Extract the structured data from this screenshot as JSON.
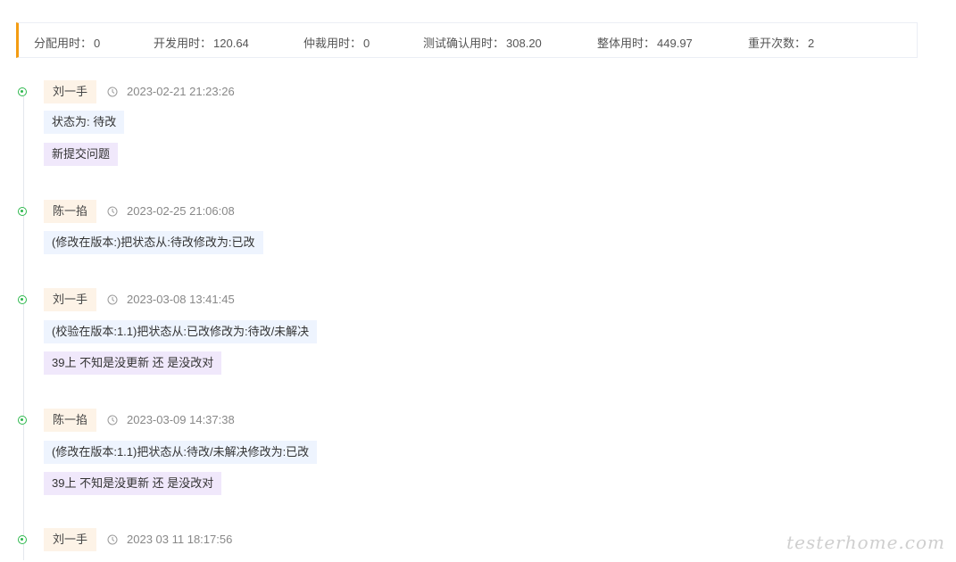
{
  "stats": [
    {
      "label": "分配用时：",
      "value": "0"
    },
    {
      "label": "开发用时：",
      "value": "120.64"
    },
    {
      "label": "仲裁用时：",
      "value": "0"
    },
    {
      "label": "测试确认用时：",
      "value": "308.20"
    },
    {
      "label": "整体用时：",
      "value": "449.97"
    },
    {
      "label": "重开次数：",
      "value": "2"
    }
  ],
  "entries": [
    {
      "author": "刘一手",
      "time": "2023-02-21 21:23:26",
      "tags": [
        {
          "text": "状态为: 待改",
          "kind": "blue"
        },
        {
          "text": "新提交问题",
          "kind": "purple"
        }
      ]
    },
    {
      "author": "陈一掐",
      "time": "2023-02-25 21:06:08",
      "tags": [
        {
          "text": "(修改在版本:)把状态从:待改修改为:已改",
          "kind": "blue"
        }
      ]
    },
    {
      "author": "刘一手",
      "time": "2023-03-08 13:41:45",
      "tags": [
        {
          "text": "(校验在版本:1.1)把状态从:已改修改为:待改/未解决",
          "kind": "blue"
        },
        {
          "text": "39上 不知是没更新 还 是没改对",
          "kind": "purple"
        }
      ]
    },
    {
      "author": "陈一掐",
      "time": "2023-03-09 14:37:38",
      "tags": [
        {
          "text": "(修改在版本:1.1)把状态从:待改/未解决修改为:已改",
          "kind": "blue"
        },
        {
          "text": "39上 不知是没更新 还 是没改对",
          "kind": "purple"
        }
      ]
    },
    {
      "author": "刘一手",
      "time": "2023 03 11 18:17:56",
      "tags": []
    }
  ],
  "watermark": "testerhome.com",
  "colors": {
    "accent_orange": "#f39c12",
    "dot_green": "#2db84d",
    "author_bg": "#fdf3e7",
    "tag_blue_bg": "#eef4fe",
    "tag_purple_bg": "#f0e8fb"
  },
  "icons": {
    "time": "clock-icon",
    "node": "timeline-dot-icon"
  }
}
